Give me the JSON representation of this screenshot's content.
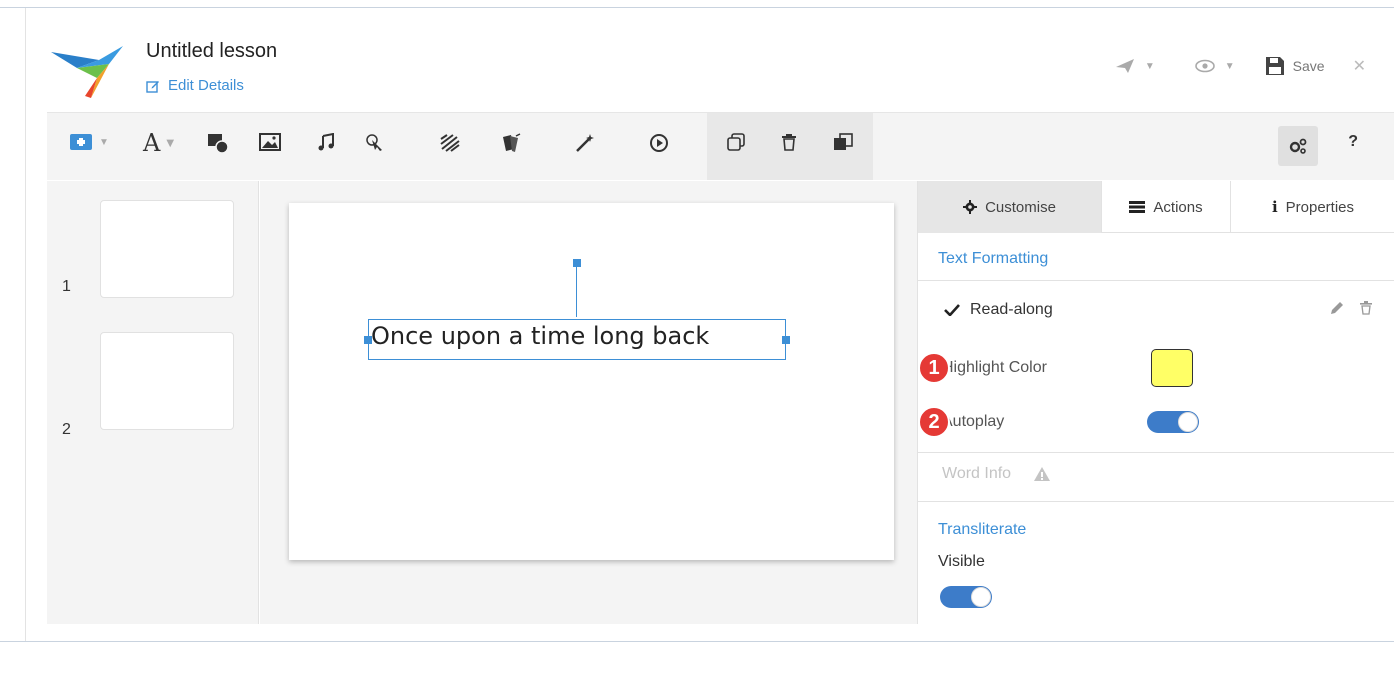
{
  "header": {
    "title": "Untitled lesson",
    "edit_details": "Edit Details",
    "save_label": "Save"
  },
  "slides": [
    {
      "number": "1"
    },
    {
      "number": "2"
    }
  ],
  "canvas": {
    "text": "Once upon a time long back"
  },
  "panel": {
    "tabs": [
      {
        "label": "Customise",
        "icon": "gear-icon",
        "active": true
      },
      {
        "label": "Actions",
        "icon": "actions-list-icon",
        "active": false
      },
      {
        "label": "Properties",
        "icon": "info-icon",
        "active": false
      }
    ],
    "text_formatting": "Text Formatting",
    "readalong_label": "Read-along",
    "highlight_color_label": "Highlight Color",
    "highlight_color": "#ffff66",
    "autoplay_label": "Autoplay",
    "autoplay_on": true,
    "badge1": "1",
    "badge2": "2",
    "word_info": "Word Info",
    "transliterate": "Transliterate",
    "visible_label": "Visible",
    "visible_on": true
  },
  "colors": {
    "accent": "#3d8fd6",
    "toggle": "#3d7cc9",
    "badge": "#e53935"
  }
}
